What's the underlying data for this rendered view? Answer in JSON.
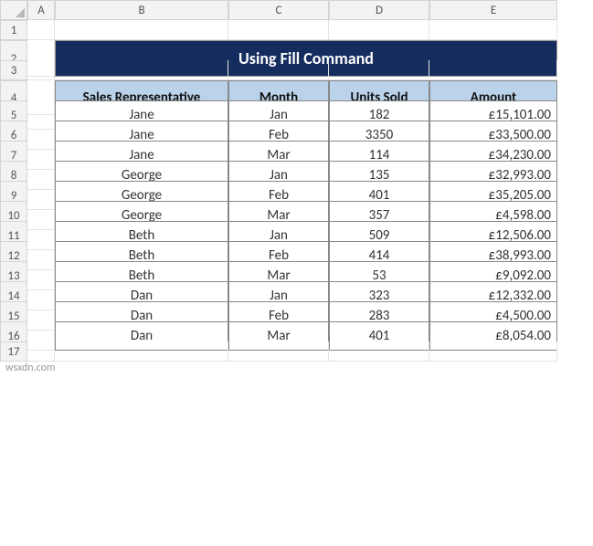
{
  "cols": [
    "A",
    "B",
    "C",
    "D",
    "E"
  ],
  "title": "Using Fill Command",
  "headers": [
    "Sales Representative",
    "Month",
    "Units Sold",
    "Amount"
  ],
  "rows": [
    {
      "rep": "Jane",
      "month": "Jan",
      "units": "182",
      "amount": "£15,101.00"
    },
    {
      "rep": "Jane",
      "month": "Feb",
      "units": "3350",
      "amount": "£33,500.00"
    },
    {
      "rep": "Jane",
      "month": "Mar",
      "units": "114",
      "amount": "£34,230.00"
    },
    {
      "rep": "George",
      "month": "Jan",
      "units": "135",
      "amount": "£32,993.00"
    },
    {
      "rep": "George",
      "month": "Feb",
      "units": "401",
      "amount": "£35,205.00"
    },
    {
      "rep": "George",
      "month": "Mar",
      "units": "357",
      "amount": "£4,598.00"
    },
    {
      "rep": "Beth",
      "month": "Jan",
      "units": "509",
      "amount": "£12,506.00"
    },
    {
      "rep": "Beth",
      "month": "Feb",
      "units": "414",
      "amount": "£38,993.00"
    },
    {
      "rep": "Beth",
      "month": "Mar",
      "units": "53",
      "amount": "£9,092.00"
    },
    {
      "rep": "Dan",
      "month": "Jan",
      "units": "323",
      "amount": "£12,332.00"
    },
    {
      "rep": "Dan",
      "month": "Feb",
      "units": "283",
      "amount": "£4,500.00"
    },
    {
      "rep": "Dan",
      "month": "Mar",
      "units": "401",
      "amount": "£8,054.00"
    }
  ],
  "row_numbers": [
    "1",
    "2",
    "3",
    "4",
    "5",
    "6",
    "7",
    "8",
    "9",
    "10",
    "11",
    "12",
    "13",
    "14",
    "15",
    "16",
    "17"
  ],
  "watermark": "wsxdn.com"
}
